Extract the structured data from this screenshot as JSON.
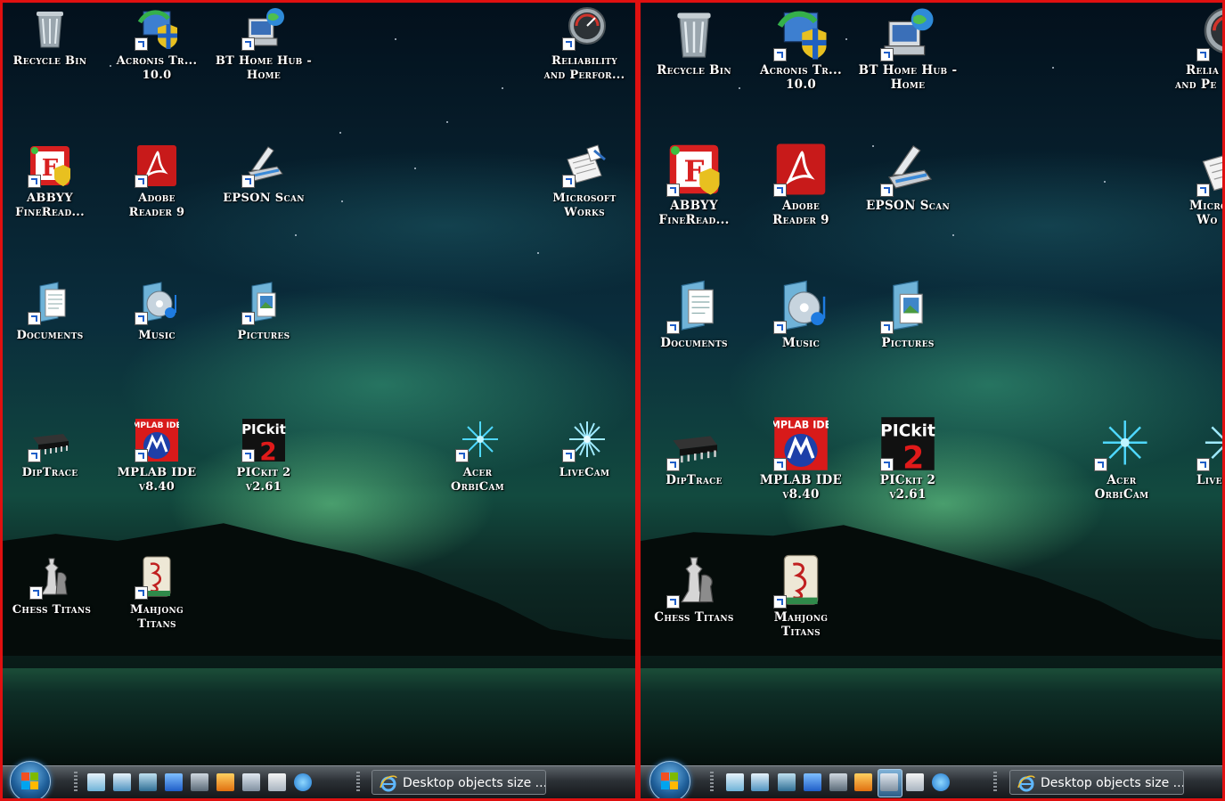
{
  "left": {
    "icons": {
      "recycle_bin": "Recycle Bin",
      "acronis_1": "Acronis Tr...",
      "acronis_2": "10.0",
      "bt_1": "BT Home Hub -",
      "bt_2": "Home",
      "reliability_1": "Reliability",
      "reliability_2": "and Perfor...",
      "abbyy_1": "ABBYY",
      "abbyy_2": "FineRead...",
      "adobe_1": "Adobe",
      "adobe_2": "Reader 9",
      "epson": "EPSON Scan",
      "works_1": "Microsoft",
      "works_2": "Works",
      "documents": "Documents",
      "music": "Music",
      "pictures": "Pictures",
      "diptrace": "DipTrace",
      "mplab_1": "MPLAB IDE",
      "mplab_2": "v8.40",
      "pickit_1": "PICkit 2",
      "pickit_2": "v2.61",
      "orbicam_1": "Acer",
      "orbicam_2": "OrbiCam",
      "livecam": "LiveCam",
      "chess": "Chess Titans",
      "mahjong_1": "Mahjong",
      "mahjong_2": "Titans"
    },
    "taskbar_button": "Desktop objects size ..."
  },
  "right": {
    "icons": {
      "recycle_bin": "Recycle Bin",
      "acronis_1": "Acronis Tr...",
      "acronis_2": "10.0",
      "bt_1": "BT Home Hub -",
      "bt_2": "Home",
      "reliability_1": "Relia",
      "reliability_2": "and Pe",
      "abbyy_1": "ABBYY",
      "abbyy_2": "FineRead...",
      "adobe_1": "Adobe",
      "adobe_2": "Reader 9",
      "epson": "EPSON Scan",
      "works_1": "Micro",
      "works_2": "Wo",
      "documents": "Documents",
      "music": "Music",
      "pictures": "Pictures",
      "diptrace": "DipTrace",
      "mplab_1": "MPLAB IDE",
      "mplab_2": "v8.40",
      "pickit_1": "PICkit 2",
      "pickit_2": "v2.61",
      "orbicam_1": "Acer",
      "orbicam_2": "OrbiCam",
      "livecam": "Live",
      "chess": "Chess Titans",
      "mahjong_1": "Mahjong",
      "mahjong_2": "Titans"
    },
    "taskbar_button": "Desktop objects size ..."
  },
  "icon_glyphs": {
    "recycle_bin": "recycle-bin-icon",
    "acronis": "acronis-true-image-icon",
    "bt": "bt-home-hub-icon",
    "reliability": "reliability-monitor-icon",
    "abbyy": "abbyy-finereader-icon",
    "adobe": "adobe-reader-icon",
    "epson": "epson-scan-icon",
    "works": "microsoft-works-icon",
    "documents": "documents-folder-icon",
    "music": "music-folder-icon",
    "pictures": "pictures-folder-icon",
    "diptrace": "chip-icon",
    "mplab": "mplab-ide-icon",
    "pickit": "pickit-2-icon",
    "orbicam": "orbicam-icon",
    "livecam": "livecam-icon",
    "chess": "chess-titans-icon",
    "mahjong": "mahjong-titans-icon"
  },
  "mplab_badge": "MPLAB IDE",
  "pickit_badge": "PICkit",
  "pickit_digit": "2",
  "colors": {
    "panel_border": "#e01010",
    "label_text": "#ffffff",
    "taskbar": "#2c3136",
    "aurora": "#4fbf8c"
  }
}
